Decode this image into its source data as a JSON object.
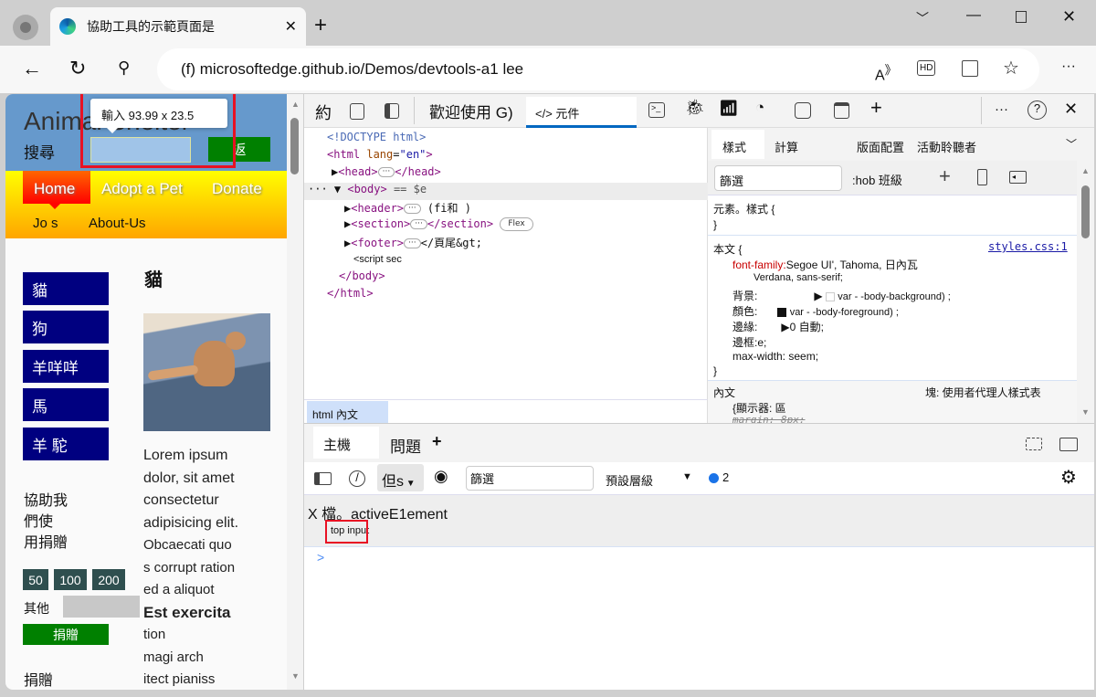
{
  "browser": {
    "tab_title": "協助工具的示範頁面是",
    "new_tab": "+",
    "url": "(f) microsoftedge.github.io/Demos/devtools-a1 lee",
    "window_controls": [
      "chevron-down",
      "minimize",
      "maximize",
      "close"
    ]
  },
  "page": {
    "title": "Animal Shelter",
    "search_label": "搜尋",
    "search_button": "返",
    "tooltip": "輸入 93.99 x 23.5",
    "nav": [
      "Home",
      "Adopt a Pet",
      "Donate",
      "Jo s",
      "About-Us"
    ],
    "sidebar": [
      "貓",
      "狗",
      "羊咩咩",
      "馬",
      "羊 駝"
    ],
    "heading": "貓",
    "donate_text": [
      "協助我",
      "們使",
      "用捐贈"
    ],
    "amounts": [
      "50",
      "100",
      "200"
    ],
    "other_label": "其他",
    "donate_button": "捐贈",
    "footer_label": "捐贈",
    "lorem": [
      "Lorem ipsum",
      "dolor, sit amet",
      "consectetur",
      "adipisicing elit.",
      "Obcaecati quo",
      "s corrupt ration",
      "ed a aliquot",
      "Est exercita",
      "tion",
      "magi arch",
      "itect pianiss"
    ]
  },
  "devtools": {
    "toolbar": {
      "inspect": "約",
      "welcome": "歡迎使用 G)",
      "elements_tab": "元件"
    },
    "tree": {
      "doctype": "<!DOCTYPE html>",
      "html_open": "<html",
      "lang_attr": "lang",
      "lang_val": "\"en\"",
      "head": "<head>",
      "head_close": "</head>",
      "body": "<body>",
      "body_eq": "== $e",
      "header": "<header>",
      "header_after": "(fi和 )",
      "section": "<section>",
      "section_close": "</section>",
      "flex_badge": "Flex",
      "footer": "<footer>",
      "footer_after": "</頁尾&gt;",
      "script": "<script sec",
      "body_close": "</body>",
      "html_close": "</html>"
    },
    "breadcrumb": "html 內文",
    "styles": {
      "tabs": [
        "樣式",
        "計算",
        "版面配置",
        "活動聆聽者"
      ],
      "filter_placeholder": "篩選",
      "hov_cls": ":hob 班級",
      "element_style": "元素。樣式 {",
      "close_brace": "}",
      "rule_selector": "本文 {",
      "rule_source": "styles.css:1",
      "props": [
        {
          "name": "font-family:",
          "value": "Segoe UI', Tahoma, 日內瓦"
        },
        {
          "name": "",
          "value": "Verdana, sans-serif;"
        },
        {
          "name": "背景:",
          "value": "var - -body-background) ;"
        },
        {
          "name": "顏色:",
          "value": "var - -body-foreground) ;"
        },
        {
          "name": "邊緣:",
          "value": "0 自動;"
        },
        {
          "name": "邊框:",
          "value": "e;"
        },
        {
          "name": "max-width:",
          "value": "seem;"
        }
      ],
      "ua_selector": "內文",
      "ua_label": "塊: 使用者代理人樣式表",
      "ua_prop": "{顯示器: 區",
      "ua_struck": "margin: 8px;"
    },
    "drawer": {
      "tabs": [
        "主機",
        "問題"
      ],
      "add": "+",
      "levels_btn": "但s",
      "filter": "篩選",
      "default_levels": "預設層級",
      "issues_count": "2",
      "command": "X 檔。activeE1ement",
      "result": "top input",
      "prompt": ">"
    }
  },
  "colors": {
    "accent": "#0067c0",
    "highlight": "#e81123",
    "header": "#6699cc",
    "sidebar": "#000080",
    "green": "#008000"
  }
}
